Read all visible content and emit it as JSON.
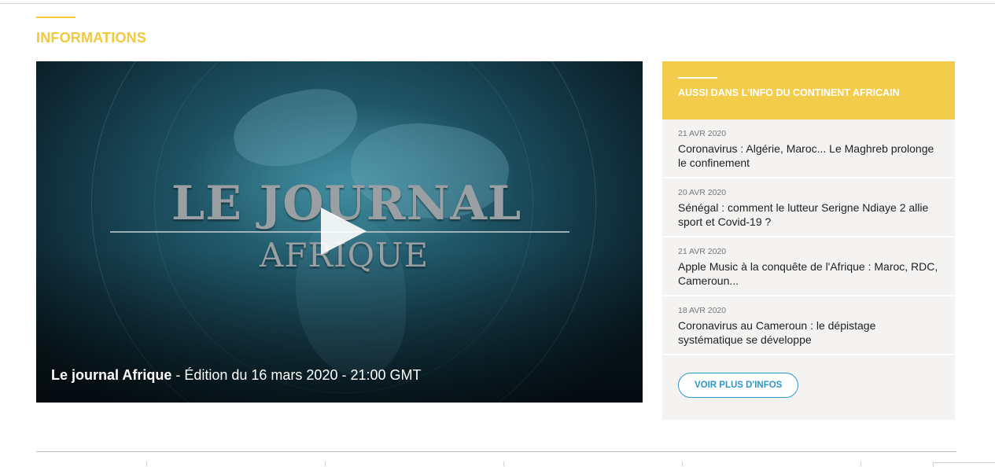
{
  "section": {
    "title": "INFORMATIONS"
  },
  "video": {
    "logo_line1": "LE JOURNAL",
    "logo_line2": "AFRIQUE",
    "caption_bold": "Le journal Afrique",
    "caption_rest": " - Édition du 16 mars 2020 - 21:00 GMT",
    "play_icon": "play-icon"
  },
  "sidebar": {
    "title": "AUSSI DANS L'INFO DU CONTINENT AFRICAIN",
    "items": [
      {
        "date": "21 AVR 2020",
        "title": "Coronavirus : Algérie, Maroc... Le Maghreb prolonge le confinement"
      },
      {
        "date": "20 AVR 2020",
        "title": "Sénégal : comment le lutteur Serigne Ndiaye 2 allie sport et Covid-19 ?"
      },
      {
        "date": "21 AVR 2020",
        "title": "Apple Music à la conquête de l'Afrique : Maroc, RDC, Cameroun..."
      },
      {
        "date": "18 AVR 2020",
        "title": "Coronavirus au Cameroun : le dépistage systématique se développe"
      }
    ],
    "more_label": "VOIR PLUS D'INFOS"
  },
  "colors": {
    "accent": "#f0c93e",
    "header_bg": "#f3cc4b",
    "link": "#2a98c9",
    "sidebar_bg": "#f4f3f1"
  }
}
